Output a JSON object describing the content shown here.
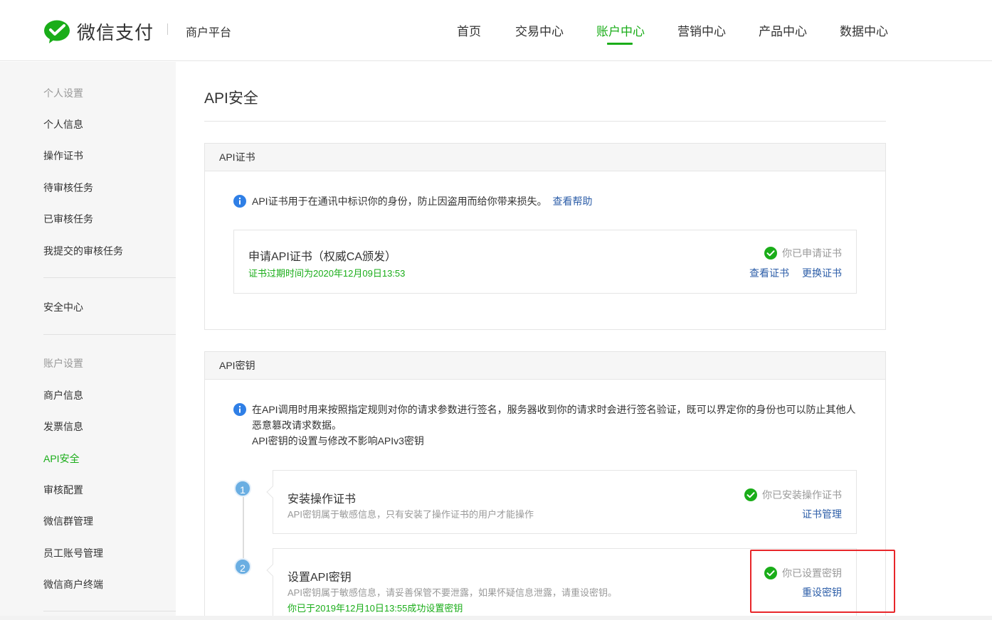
{
  "header": {
    "logo_text": "微信支付",
    "platform": "商户平台",
    "nav": [
      {
        "label": "首页",
        "active": false
      },
      {
        "label": "交易中心",
        "active": false
      },
      {
        "label": "账户中心",
        "active": true
      },
      {
        "label": "营销中心",
        "active": false
      },
      {
        "label": "产品中心",
        "active": false
      },
      {
        "label": "数据中心",
        "active": false
      }
    ]
  },
  "sidebar": {
    "group_personal": "个人设置",
    "personal_items": [
      "个人信息",
      "操作证书",
      "待审核任务",
      "已审核任务",
      "我提交的审核任务"
    ],
    "security": "安全中心",
    "group_account": "账户设置",
    "account_items": [
      "商户信息",
      "发票信息",
      "API安全",
      "审核配置",
      "微信群管理",
      "员工账号管理",
      "微信商户终端"
    ],
    "active_item": "API安全"
  },
  "main": {
    "title": "API安全",
    "cert_panel": {
      "header": "API证书",
      "notice": "API证书用于在通讯中标识你的身份，防止因盗用而给你带来损失。",
      "help_link": "查看帮助",
      "card": {
        "title": "申请API证书（权威CA颁发）",
        "expiry": "证书过期时间为2020年12月09日13:53",
        "status": "你已申请证书",
        "link_view": "查看证书",
        "link_change": "更换证书"
      }
    },
    "key_panel": {
      "header": "API密钥",
      "notice_line1": "在API调用时用来按照指定规则对你的请求参数进行签名，服务器收到你的请求时会进行签名验证，既可以界定你的身份也可以防止其他人",
      "notice_line2": "恶意篡改请求数据。",
      "notice_line3": "API密钥的设置与修改不影响APIv3密钥",
      "steps": [
        {
          "num": "1",
          "title": "安装操作证书",
          "desc": "API密钥属于敏感信息，只有安装了操作证书的用户才能操作",
          "status": "你已安装操作证书",
          "link": "证书管理"
        },
        {
          "num": "2",
          "title": "设置API密钥",
          "desc": "API密钥属于敏感信息，请妥善保管不要泄露，如果怀疑信息泄露，请重设密钥。",
          "set_time": "你已于2019年12月10日13:55成功设置密钥",
          "status": "你已设置密钥",
          "link": "重设密钥"
        }
      ]
    }
  },
  "colors": {
    "brand_green": "#1aad19",
    "link_blue": "#2d5ea8",
    "step_blue": "#6aaee2",
    "highlight_red": "#e8262a"
  }
}
